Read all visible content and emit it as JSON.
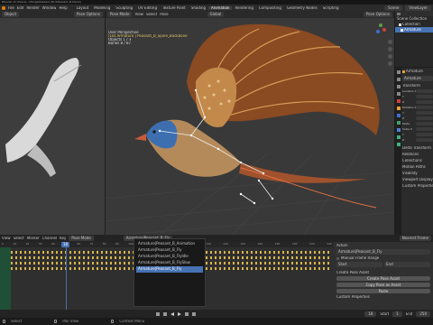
{
  "titlebar": {
    "title": "Blender [C:\\Users\\...\\Wings\\Peasant_Bird\\Peasant_B.blend]"
  },
  "menubar": {
    "menus": [
      "File",
      "Edit",
      "Render",
      "Window",
      "Help"
    ],
    "workspaces": [
      "Layout",
      "Modeling",
      "Sculpting",
      "UV Editing",
      "Texture Paint",
      "Shading",
      "Animation",
      "Rendering",
      "Compositing",
      "Geometry Nodes",
      "Scripting"
    ],
    "active_workspace": "Animation",
    "scene_label": "Scene",
    "view_layer_label": "ViewLayer"
  },
  "left_viewport": {
    "mode": "Object",
    "options": "Pose Options"
  },
  "main_viewport": {
    "mode": "Pose Mode",
    "menus": [
      "View",
      "Select",
      "Pose"
    ],
    "transform": "Global",
    "options": "Pose Options",
    "overlay_lines": [
      "User Perspective",
      "(18) Armature | Peasant_B_Spine_Backbone",
      "Objects   1 / 3",
      "Bones     8 / 87"
    ]
  },
  "outliner": {
    "title": "Scene Collection",
    "items": [
      "Collection",
      "Armature"
    ]
  },
  "properties": {
    "object_name": "Armature",
    "object_field": "Armature",
    "sections": [
      "Transform",
      "Delta Transform",
      "Relations",
      "Collections",
      "Motion Paths",
      "Visibility",
      "Viewport Display",
      "Custom Properties"
    ],
    "fields": [
      "Location X",
      "Y",
      "Z",
      "Rotation X",
      "Y",
      "Z",
      "Mode",
      "Scale X",
      "Y",
      "Z"
    ]
  },
  "timeline": {
    "menus": [
      "View",
      "Select",
      "Marker",
      "Channel",
      "Key"
    ],
    "mode": "Pose Mode",
    "action_dropdown": "Armature|Peasant_B_Fly",
    "current_frame": "18",
    "ticks_left": [
      "0",
      "10",
      "20",
      "30",
      "40",
      "50",
      "60",
      "70",
      "80",
      "90",
      "100"
    ],
    "ticks_right": [
      "100",
      "120",
      "140",
      "160",
      "180",
      "200",
      "220",
      "240"
    ],
    "actions": [
      "Armature|Peasant_B_Animation",
      "Armature|Peasant_B_Fly",
      "Armature|Peasant_B_FlyIdle",
      "Armature|Peasant_B_FlySlow",
      "Armature|Peasant_B_Fly"
    ],
    "selected_action_index": 4,
    "side_panel": {
      "header": "Nearest Frame",
      "action_label": "Action",
      "action_value": "Armature|Peasant_B_Fly",
      "manual_range": "Manual Frame Range",
      "start": "Start",
      "end": "End",
      "pose_section": "Create Pose Asset",
      "create_pose": "Create Pose Asset",
      "copy_pose": "Copy Pose as Asset",
      "paste_pose": "Paste",
      "custom_section": "Custom Properties"
    },
    "playback": {
      "start_label": "Start",
      "start": "1",
      "end_label": "End",
      "end": "250",
      "frame": "18"
    }
  },
  "statusbar": {
    "left": "Select",
    "middle": "Pan View",
    "right": "Context Menu"
  }
}
